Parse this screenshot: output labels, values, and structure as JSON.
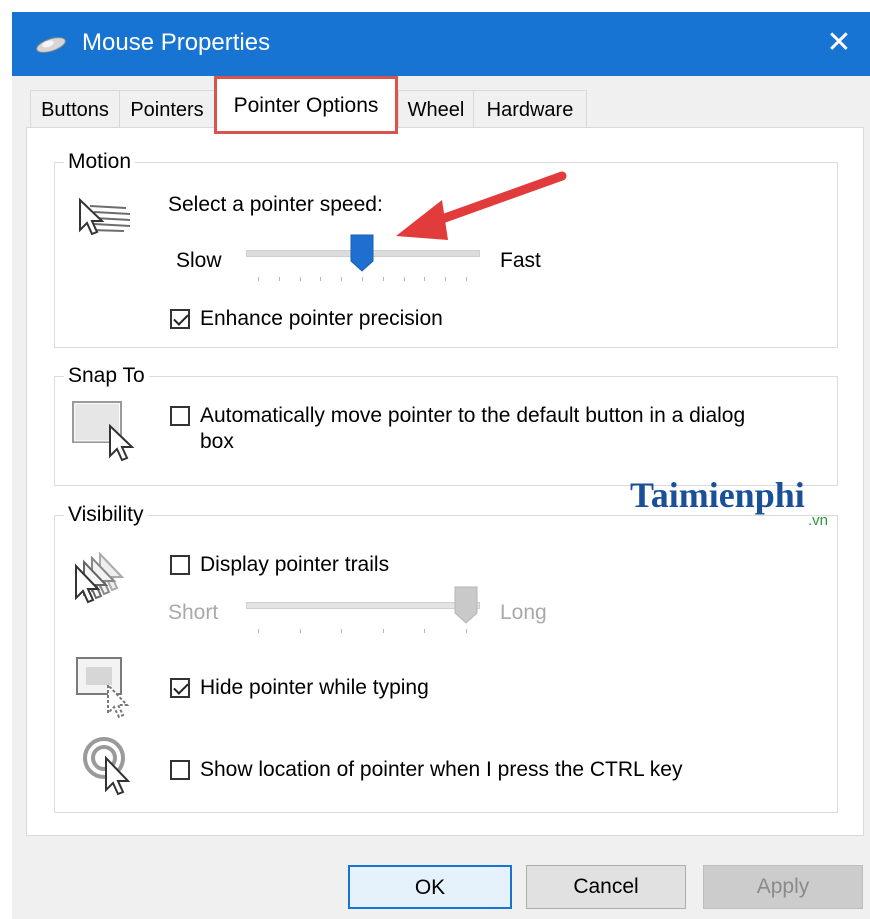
{
  "window": {
    "title": "Mouse Properties",
    "close_glyph": "✕"
  },
  "tabs": [
    {
      "label": "Buttons"
    },
    {
      "label": "Pointers"
    },
    {
      "label": "Pointer Options"
    },
    {
      "label": "Wheel"
    },
    {
      "label": "Hardware"
    }
  ],
  "motion": {
    "legend": "Motion",
    "speed_label": "Select a pointer speed:",
    "slow_label": "Slow",
    "fast_label": "Fast",
    "speed_value_fraction": 0.5,
    "enhance_label": "Enhance pointer precision",
    "enhance_checked": true
  },
  "snap_to": {
    "legend": "Snap To",
    "auto_move_line1": "Automatically move pointer to the default button in a dialog",
    "auto_move_line2": "box",
    "auto_move_checked": false
  },
  "visibility": {
    "legend": "Visibility",
    "trails_label": "Display pointer trails",
    "trails_checked": false,
    "short_label": "Short",
    "long_label": "Long",
    "trails_value_fraction": 1.0,
    "hide_label": "Hide pointer while typing",
    "hide_checked": true,
    "ctrl_label": "Show location of pointer when I press the CTRL key",
    "ctrl_checked": false
  },
  "buttons": {
    "ok": "OK",
    "cancel": "Cancel",
    "apply": "Apply"
  },
  "watermark": {
    "brand": "Taimienphi",
    "suffix": ".vn"
  },
  "colors": {
    "titlebar": "#1874d2",
    "highlight": "#d9534f",
    "thumb": "#1f6fd1",
    "arrow": "#e23b3b"
  }
}
